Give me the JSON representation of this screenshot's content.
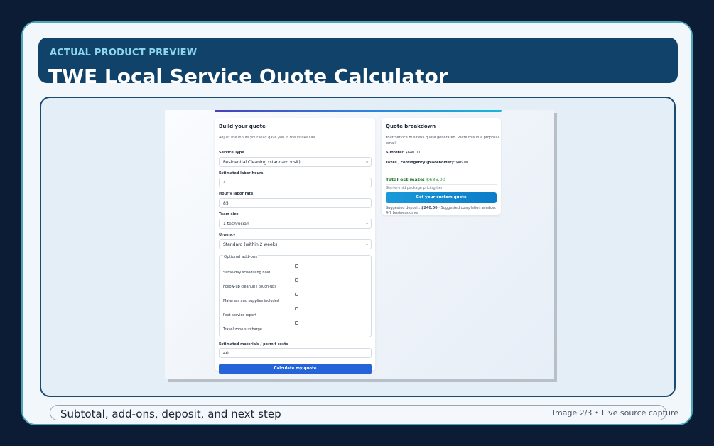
{
  "header": {
    "eyebrow": "ACTUAL PRODUCT PREVIEW",
    "title": "TWE Local Service Quote Calculator"
  },
  "form": {
    "title": "Build your quote",
    "description": "Adjust the inputs your lead gave you in the intake call.",
    "service_type": {
      "label": "Service Type",
      "value": "Residential Cleaning (standard visit)"
    },
    "labor_hours": {
      "label": "Estimated labor hours",
      "value": "4"
    },
    "hourly_rate": {
      "label": "Hourly labor rate",
      "value": "85"
    },
    "team_size": {
      "label": "Team size",
      "value": "1 technician"
    },
    "urgency": {
      "label": "Urgency",
      "value": "Standard (within 2 weeks)"
    },
    "addons": {
      "legend": "Optional add-ons",
      "items": [
        {
          "label": "Same-day scheduling hold",
          "checked": false
        },
        {
          "label": "Follow-up cleanup / touch-ups",
          "checked": false
        },
        {
          "label": "Materials and supplies included",
          "checked": false
        },
        {
          "label": "Post-service report",
          "checked": false
        },
        {
          "label": "Travel zone surcharge",
          "checked": false
        }
      ]
    },
    "materials": {
      "label": "Estimated materials / permit costs",
      "value": "40"
    },
    "submit_label": "Calculate my quote"
  },
  "quote": {
    "title": "Quote breakdown",
    "description": "Your Service Business quote generated. Paste this in a proposal email.",
    "subtotal_label": "Subtotal:",
    "subtotal_value": "$640.00",
    "taxes_label": "Taxes / contingency (placeholder):",
    "taxes_value": "$46.00",
    "total_label": "Total estimate:",
    "total_value": "$686.00",
    "tier": "Starter-mid package pricing tier",
    "cta_label": "Get your custom quote",
    "deposit_prefix": "Suggested deposit:",
    "deposit_value": "$240.00",
    "completion_text": "· Suggested completion window: 4-7 business days"
  },
  "caption": {
    "text": "Subtotal, add-ons, deposit, and next step",
    "meta": "Image 2/3 • Live source capture"
  },
  "icons": {
    "select_chevron": "chevron-down-icon"
  },
  "colors": {
    "page_bg": "#0c1c35",
    "header_bg": "#10426a",
    "accent_eyebrow": "#8cd6ee",
    "primary_button": "#2563d9",
    "cta_button": "#0b7cc9",
    "total_green": "#2e7d32"
  }
}
